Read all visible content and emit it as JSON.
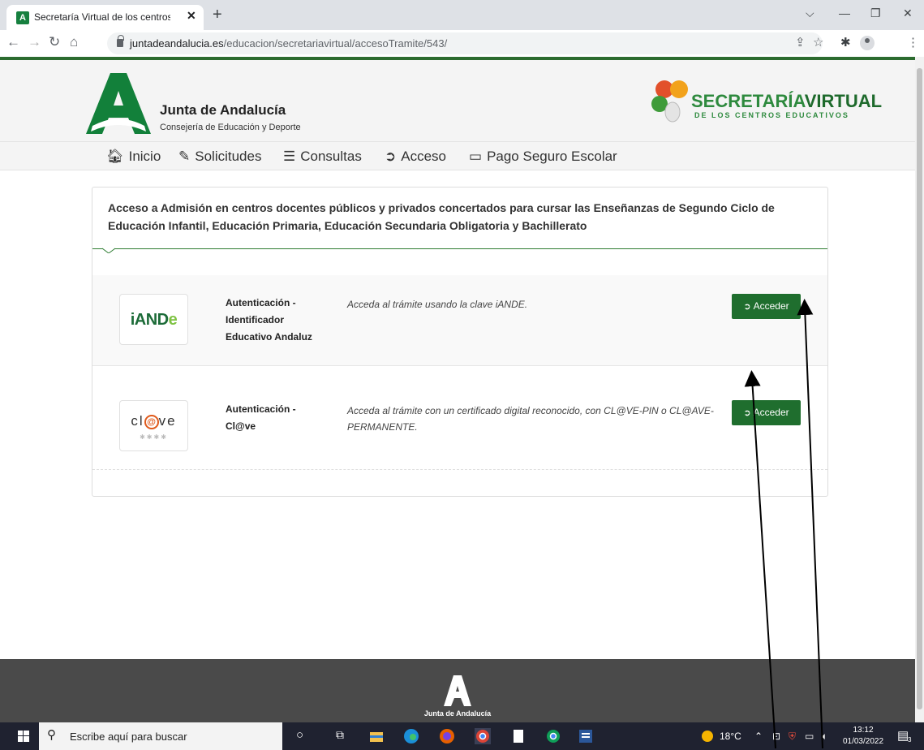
{
  "browser": {
    "tab_title": "Secretaría Virtual de los centros e",
    "tab_favicon": "A",
    "tab_close": "✕",
    "new_tab": "+",
    "url_host": "juntadeandalucia.es",
    "url_path": "/educacion/secretariavirtual/accesoTramite/543/"
  },
  "header": {
    "brand_name": "Junta de Andalucía",
    "brand_sub": "Consejería de Educación y Deporte",
    "sv_title_a": "SECRETARÍA",
    "sv_title_b": "VIRTUAL",
    "sv_sub": "DE LOS CENTROS EDUCATIVOS"
  },
  "nav": {
    "items": [
      {
        "label": "Inicio",
        "icon": "home-icon"
      },
      {
        "label": "Solicitudes",
        "icon": "pencil-icon"
      },
      {
        "label": "Consultas",
        "icon": "list-icon"
      },
      {
        "label": "Acceso",
        "icon": "sign-in-icon"
      },
      {
        "label": "Pago Seguro Escolar",
        "icon": "credit-card-icon"
      }
    ]
  },
  "panel": {
    "title": "Acceso a Admisión en centros docentes públicos y privados concertados para cursar las Enseñanzas de Segundo Ciclo de Educación Infantil, Educación Primaria, Educación Secundaria Obligatoria y Bachillerato",
    "rows": [
      {
        "logo_a": "iAND",
        "logo_b": "e",
        "auth": "Autenticación - Identificador Educativo Andaluz",
        "desc": "Acceda al trámite usando la clave iANDE.",
        "button": "Acceder"
      },
      {
        "logo_a": "cl",
        "logo_at": "@",
        "logo_b": "ve",
        "logo_stars": "✱✱✱✱",
        "auth": "Autenticación - Cl@ve",
        "desc": "Acceda al trámite con un certificado digital reconocido, con CL@VE-PIN o CL@AVE-PERMANENTE.",
        "button": "Acceder"
      }
    ]
  },
  "footer": {
    "label": "Junta de Andalucía"
  },
  "taskbar": {
    "search_placeholder": "Escribe aquí para buscar",
    "weather": "18°C",
    "time": "13:12",
    "date": "01/03/2022",
    "notifications": "3"
  },
  "colors": {
    "brand_green": "#1f6e2e",
    "header_bg": "#f4f4f4",
    "footer_bg": "#4a4a4a"
  }
}
